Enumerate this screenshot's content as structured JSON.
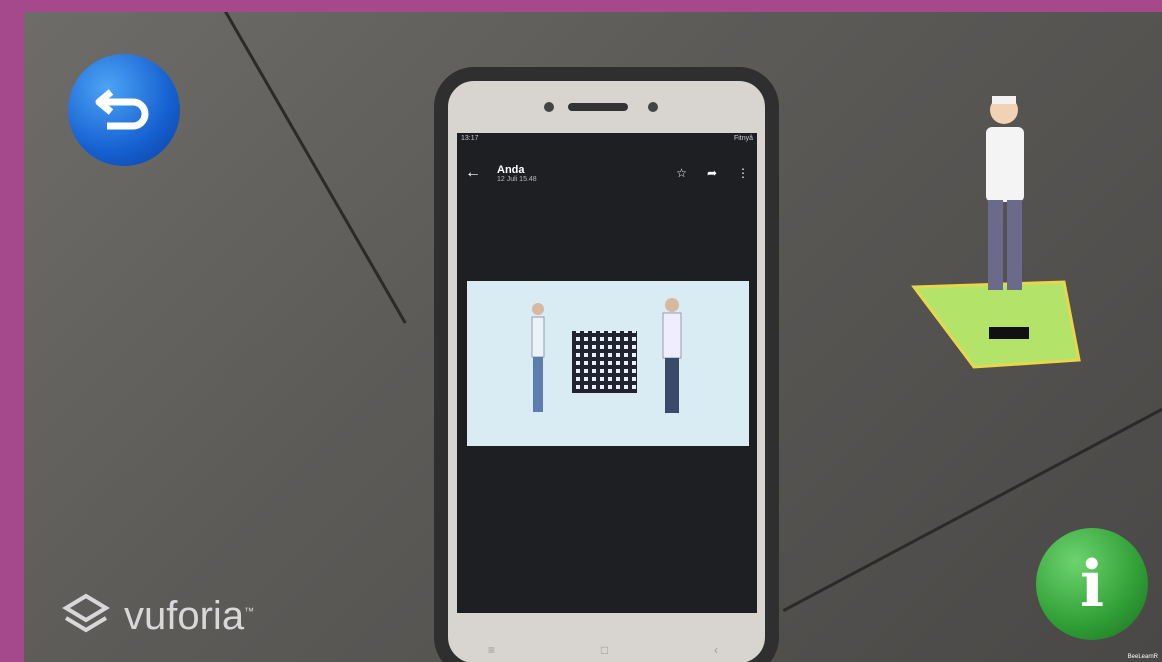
{
  "phone": {
    "status_left": "13:17",
    "status_right": "Fitnyâ",
    "chat_title": "Anda",
    "chat_sub": "12 Juli 15.48",
    "nav_buttons": [
      "≡",
      "□",
      "‹"
    ]
  },
  "overlay": {
    "back_button_icon": "undo-arrow-icon",
    "info_button_label": "i",
    "brand": "vuforia",
    "brand_tm": "™",
    "watermark": "BeeLearnR"
  },
  "colors": {
    "border": "#a6498c",
    "back_button": "#1560d1",
    "info_button": "#2f9e35",
    "mat": "#b4e36a"
  }
}
